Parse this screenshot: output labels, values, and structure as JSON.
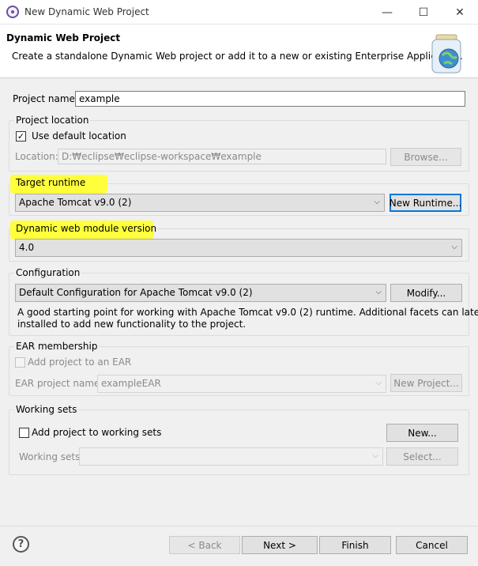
{
  "window": {
    "title": "New Dynamic Web Project",
    "minimize": "—",
    "maximize": "☐",
    "close": "✕"
  },
  "banner": {
    "title": "Dynamic Web Project",
    "description": "Create a standalone Dynamic Web project or add it to a new or existing Enterprise Application."
  },
  "project": {
    "name_label": "Project name:",
    "name_value": "example"
  },
  "location": {
    "group_label": "Project location",
    "use_default_label": "Use default location",
    "use_default_checked": "✓",
    "location_label": "Location:",
    "location_value": "D:₩eclipse₩eclipse-workspace₩example",
    "browse_label": "Browse..."
  },
  "runtime": {
    "group_label": "Target runtime",
    "selected": "Apache Tomcat v9.0 (2)",
    "new_runtime_label": "New Runtime..."
  },
  "module": {
    "group_label": "Dynamic web module version",
    "selected": "4.0"
  },
  "configuration": {
    "group_label": "Configuration",
    "selected": "Default Configuration for Apache Tomcat v9.0 (2)",
    "modify_label": "Modify...",
    "description_line1": "A good starting point for working with Apache Tomcat v9.0 (2) runtime. Additional facets can later be",
    "description_line2": "installed to add new functionality to the project."
  },
  "ear": {
    "group_label": "EAR membership",
    "add_label": "Add project to an EAR",
    "project_name_label": "EAR project name:",
    "project_name_value": "exampleEAR",
    "new_project_label": "New Project..."
  },
  "working_sets": {
    "group_label": "Working sets",
    "add_label": "Add project to working sets",
    "new_label": "New...",
    "sets_label": "Working sets:",
    "sets_value": "",
    "select_label": "Select..."
  },
  "footer": {
    "help": "?",
    "back_label": "< Back",
    "next_label": "Next >",
    "finish_label": "Finish",
    "cancel_label": "Cancel"
  },
  "colors": {
    "highlight": "#ffff3c",
    "focus": "#0078d7"
  }
}
